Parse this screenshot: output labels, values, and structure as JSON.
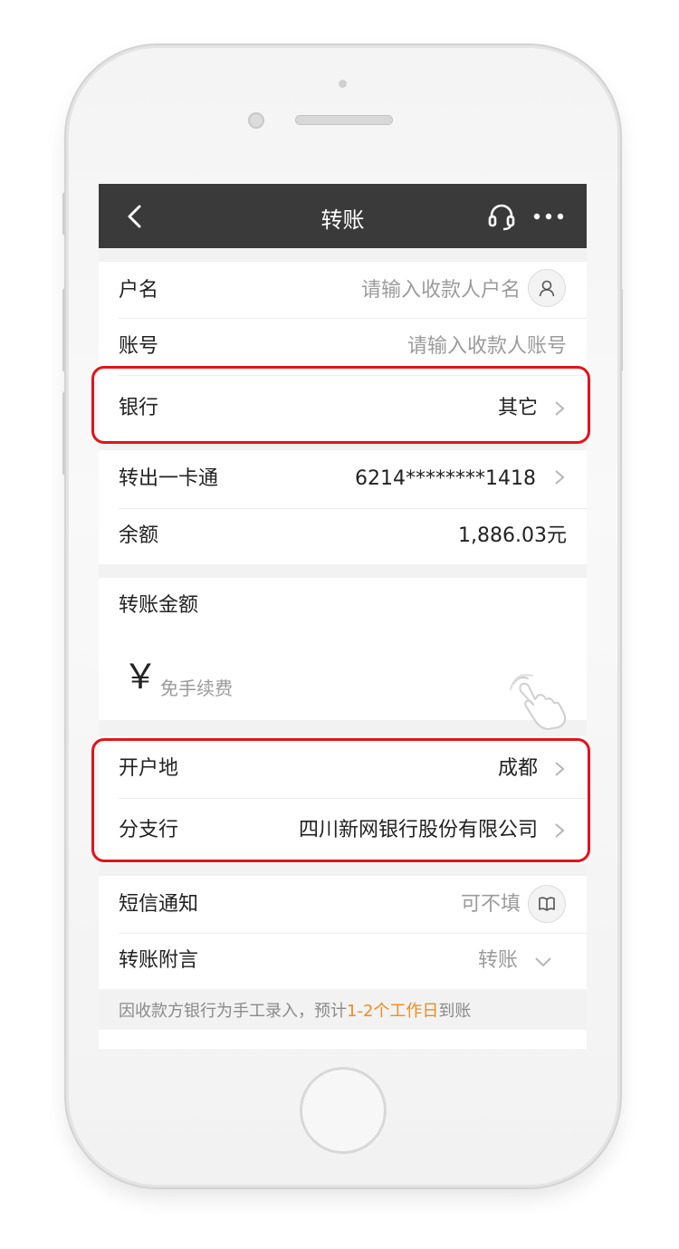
{
  "header": {
    "title": "转账"
  },
  "payee": {
    "name_label": "户名",
    "name_placeholder": "请输入收款人户名",
    "account_label": "账号",
    "account_placeholder": "请输入收款人账号",
    "bank_label": "银行",
    "bank_value": "其它"
  },
  "source": {
    "card_label": "转出一卡通",
    "card_value": "6214********1418",
    "balance_label": "余额",
    "balance_value": "1,886.03元"
  },
  "amount": {
    "label": "转账金额",
    "currency_symbol": "￥",
    "placeholder": "免手续费"
  },
  "branch": {
    "region_label": "开户地",
    "region_value": "成都",
    "branch_label": "分支行",
    "branch_value": "四川新网银行股份有限公司"
  },
  "extras": {
    "sms_label": "短信通知",
    "sms_placeholder": "可不填",
    "memo_label": "转账附言",
    "memo_value": "转账"
  },
  "notice": {
    "prefix": "因收款方银行为手工录入，预计",
    "highlight": "1-2个工作日",
    "suffix": "到账"
  },
  "colors": {
    "navbar": "#3a3a3a",
    "highlight_box": "#e2131b",
    "notice_accent": "#f08b1a"
  },
  "icons": {
    "back": "chevron-left-icon",
    "service": "headset-icon",
    "more": "more-dots-icon",
    "contact": "person-icon",
    "address_book": "book-icon",
    "gesture": "tap-hand-icon"
  }
}
